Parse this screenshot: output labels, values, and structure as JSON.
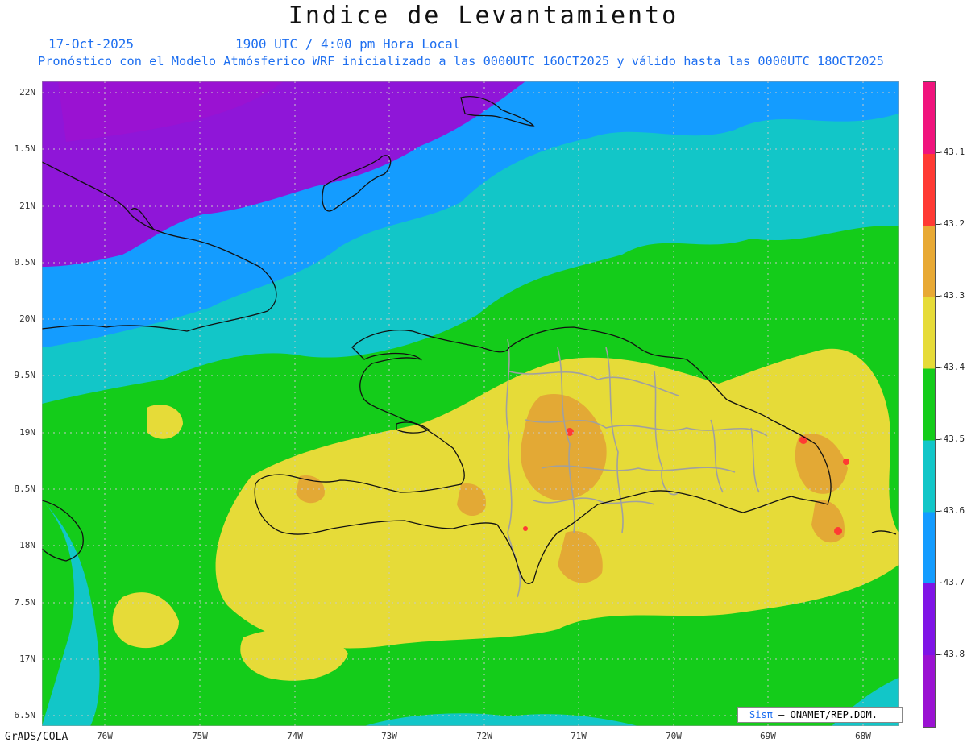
{
  "header": {
    "title": "Indice de Levantamiento",
    "date": "17-Oct-2025",
    "time": "1900 UTC / 4:00 pm Hora Local",
    "forecast": "Pronóstico con el Modelo Atmósferico WRF inicializado a las 0000UTC_16OCT2025 y válido hasta las  0000UTC_18OCT2025"
  },
  "axes": {
    "lat_labels": [
      "22N",
      "1.5N",
      "21N",
      "0.5N",
      "20N",
      "9.5N",
      "19N",
      "8.5N",
      "18N",
      "7.5N",
      "17N",
      "6.5N"
    ],
    "lon_labels": [
      "76W",
      "75W",
      "74W",
      "73W",
      "72W",
      "71W",
      "70W",
      "69W",
      "68W"
    ]
  },
  "legend": {
    "labels": [
      "-43.1",
      "-43.2",
      "-43.3",
      "-43.4",
      "-43.5",
      "-43.6",
      "-43.7",
      "-43.8"
    ],
    "colors": [
      "#f0147d",
      "#ff3a33",
      "#e8a934",
      "#e6db38",
      "#14cc1a",
      "#12c6c8",
      "#149cff",
      "#7f14e6",
      "#9a12d2"
    ]
  },
  "map": {
    "layers": [
      "filled-contours",
      "coastline",
      "province-boundaries"
    ],
    "palette": {
      "violet": "#8f16d8",
      "blue": "#149cff",
      "cyan": "#12c6c8",
      "green": "#14cc1a",
      "yellow": "#e6db38",
      "orange": "#e3a935",
      "red": "#ff3a33",
      "coast": "#111111",
      "border": "#a0a0a0",
      "grid": "#c8c8c8"
    }
  },
  "footer": {
    "credit_logo": "Sisπ",
    "credit_text": "– ONAMET/REP.DOM.",
    "software": "GrADS/COLA"
  }
}
